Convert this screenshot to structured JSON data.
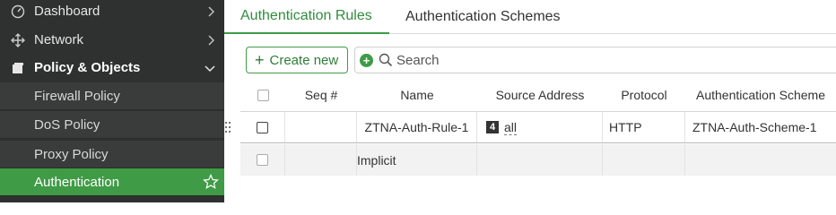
{
  "sidebar": {
    "items": [
      {
        "label": "Dashboard",
        "icon": "dashboard-icon"
      },
      {
        "label": "Network",
        "icon": "network-move-icon"
      },
      {
        "label": "Policy & Objects",
        "icon": "policy-icon"
      }
    ],
    "subitems": [
      {
        "label": "Firewall Policy"
      },
      {
        "label": "DoS Policy"
      },
      {
        "label": "Proxy Policy"
      },
      {
        "label": "Authentication"
      }
    ],
    "active_item": "Authentication",
    "colors": {
      "active_bg": "#3f9b46",
      "sidebar_bg": "#2f3030"
    }
  },
  "tabs": [
    {
      "label": "Authentication Rules",
      "active": true
    },
    {
      "label": "Authentication Schemes",
      "active": false
    }
  ],
  "toolbar": {
    "create_label": "Create new",
    "search_placeholder": "Search"
  },
  "table": {
    "columns": [
      "Seq #",
      "Name",
      "Source Address",
      "Protocol",
      "Authentication Scheme"
    ],
    "rows": [
      {
        "seq": "",
        "name": "ZTNA-Auth-Rule-1",
        "source_badge": "4",
        "source": "all",
        "protocol": "HTTP",
        "scheme": "ZTNA-Auth-Scheme-1"
      },
      {
        "seq": "",
        "name": "Implicit",
        "source": "",
        "protocol": "",
        "scheme": ""
      }
    ]
  },
  "accent_color": "#3f9b46"
}
